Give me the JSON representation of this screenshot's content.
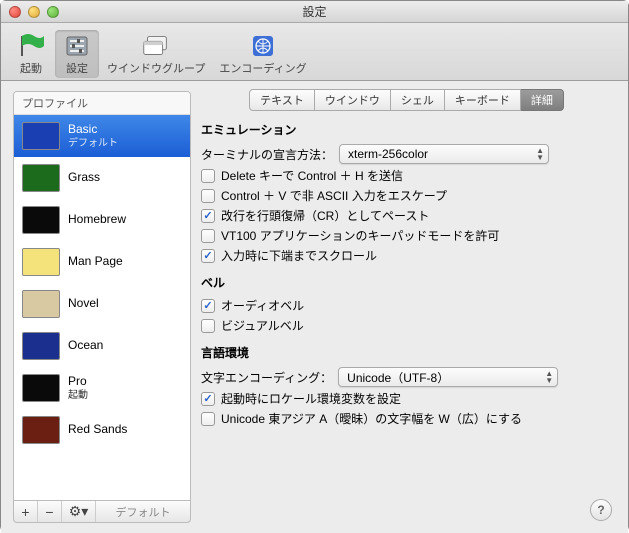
{
  "window": {
    "title": "設定"
  },
  "toolbar": {
    "items": [
      {
        "label": "起動"
      },
      {
        "label": "設定"
      },
      {
        "label": "ウインドウグループ"
      },
      {
        "label": "エンコーディング"
      }
    ]
  },
  "sidebar": {
    "header": "プロファイル",
    "profiles": [
      {
        "name": "Basic",
        "sub": "デフォルト",
        "bg": "#1a3fb3",
        "selected": true
      },
      {
        "name": "Grass",
        "sub": "",
        "bg": "#1c6b1c"
      },
      {
        "name": "Homebrew",
        "sub": "",
        "bg": "#0a0a0a"
      },
      {
        "name": "Man Page",
        "sub": "",
        "bg": "#f4e27a"
      },
      {
        "name": "Novel",
        "sub": "",
        "bg": "#d9c9a3"
      },
      {
        "name": "Ocean",
        "sub": "",
        "bg": "#1b2f8f"
      },
      {
        "name": "Pro",
        "sub": "起動",
        "bg": "#0a0a0a"
      },
      {
        "name": "Red Sands",
        "sub": "",
        "bg": "#6b1f12"
      }
    ],
    "buttons": {
      "add": "+",
      "remove": "−",
      "gear": "⚙︎▾",
      "default": "デフォルト"
    }
  },
  "tabs": [
    {
      "label": "テキスト"
    },
    {
      "label": "ウインドウ"
    },
    {
      "label": "シェル"
    },
    {
      "label": "キーボード"
    },
    {
      "label": "詳細",
      "selected": true
    }
  ],
  "sections": {
    "emulation": {
      "title": "エミュレーション",
      "terminal_decl_label": "ターミナルの宣言方法：",
      "terminal_decl_value": "xterm-256color",
      "opts": [
        {
          "label": "Delete キーで Control ＋ H を送信",
          "checked": false
        },
        {
          "label": "Control ＋ V で非 ASCII 入力をエスケープ",
          "checked": false
        },
        {
          "label": "改行を行頭復帰（CR）としてペースト",
          "checked": true
        },
        {
          "label": "VT100 アプリケーションのキーパッドモードを許可",
          "checked": false
        },
        {
          "label": "入力時に下端までスクロール",
          "checked": true
        }
      ]
    },
    "bell": {
      "title": "ベル",
      "opts": [
        {
          "label": "オーディオベル",
          "checked": true
        },
        {
          "label": "ビジュアルベル",
          "checked": false
        }
      ]
    },
    "lang": {
      "title": "言語環境",
      "encoding_label": "文字エンコーディング：",
      "encoding_value": "Unicode（UTF-8）",
      "opts": [
        {
          "label": "起動時にロケール環境変数を設定",
          "checked": true
        },
        {
          "label": "Unicode 東アジア A（曖昧）の文字幅を W（広）にする",
          "checked": false
        }
      ]
    }
  },
  "help": "?"
}
